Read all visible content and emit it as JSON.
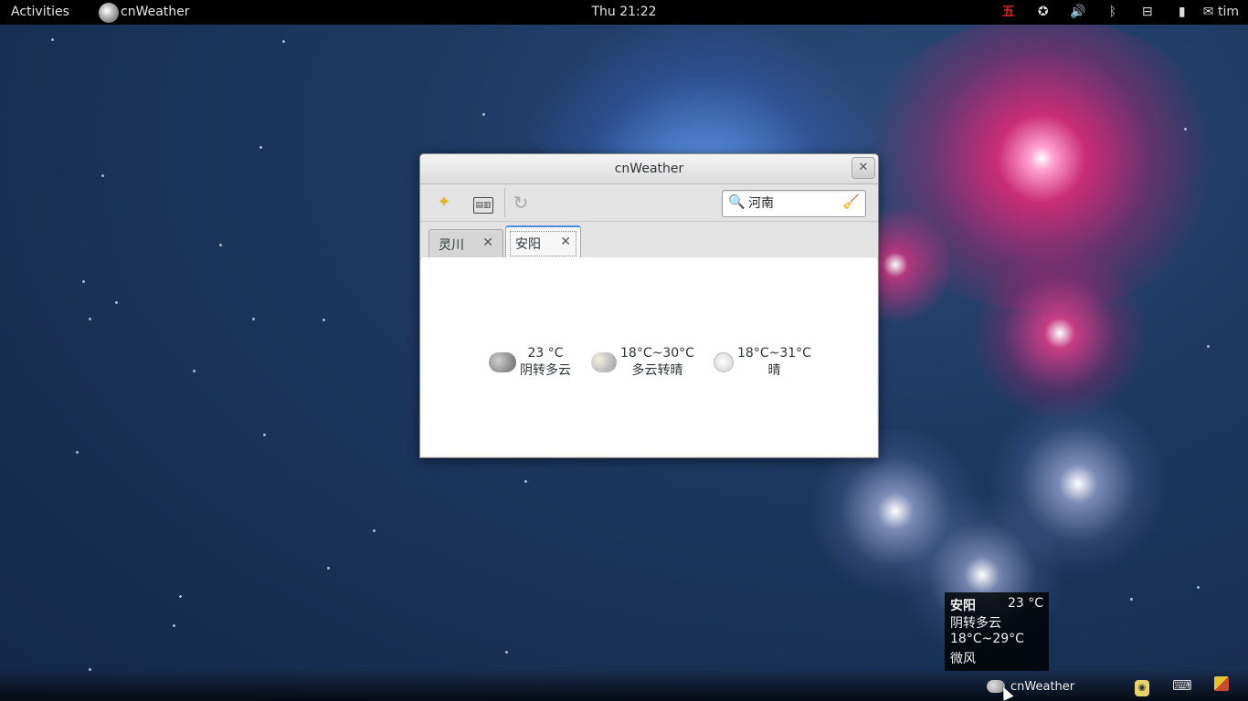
{
  "topbar": {
    "activities": "Activities",
    "app_name": "cnWeather",
    "clock": "Thu 21:22",
    "ime_label": "五",
    "user": "tim"
  },
  "window": {
    "title": "cnWeather",
    "close_glyph": "✕",
    "toolbar": {
      "favorite_icon": "star-icon",
      "settings_icon": "settings-icon",
      "refresh_icon": "refresh-icon",
      "search_value": "河南"
    },
    "tabs": [
      {
        "label": "灵川",
        "close": "✕",
        "active": false
      },
      {
        "label": "安阳",
        "close": "✕",
        "active": true
      }
    ],
    "forecast": [
      {
        "temp": "23 °C",
        "desc": "阴转多云",
        "icon": "overcast-icon"
      },
      {
        "temp": "18°C~30°C",
        "desc": "多云转晴",
        "icon": "partly-cloudy-icon"
      },
      {
        "temp": "18°C~31°C",
        "desc": "晴",
        "icon": "clear-icon"
      }
    ]
  },
  "tooltip": {
    "city": "安阳",
    "temp": "23 °C",
    "desc": "阴转多云",
    "range": "18°C~29°C",
    "wind": "微风"
  },
  "bottom_tray": {
    "app_label": "cnWeather"
  },
  "colors": {
    "accent": "#4a90d9",
    "ime_red": "#e02020",
    "star_yellow": "#e5b61c"
  }
}
